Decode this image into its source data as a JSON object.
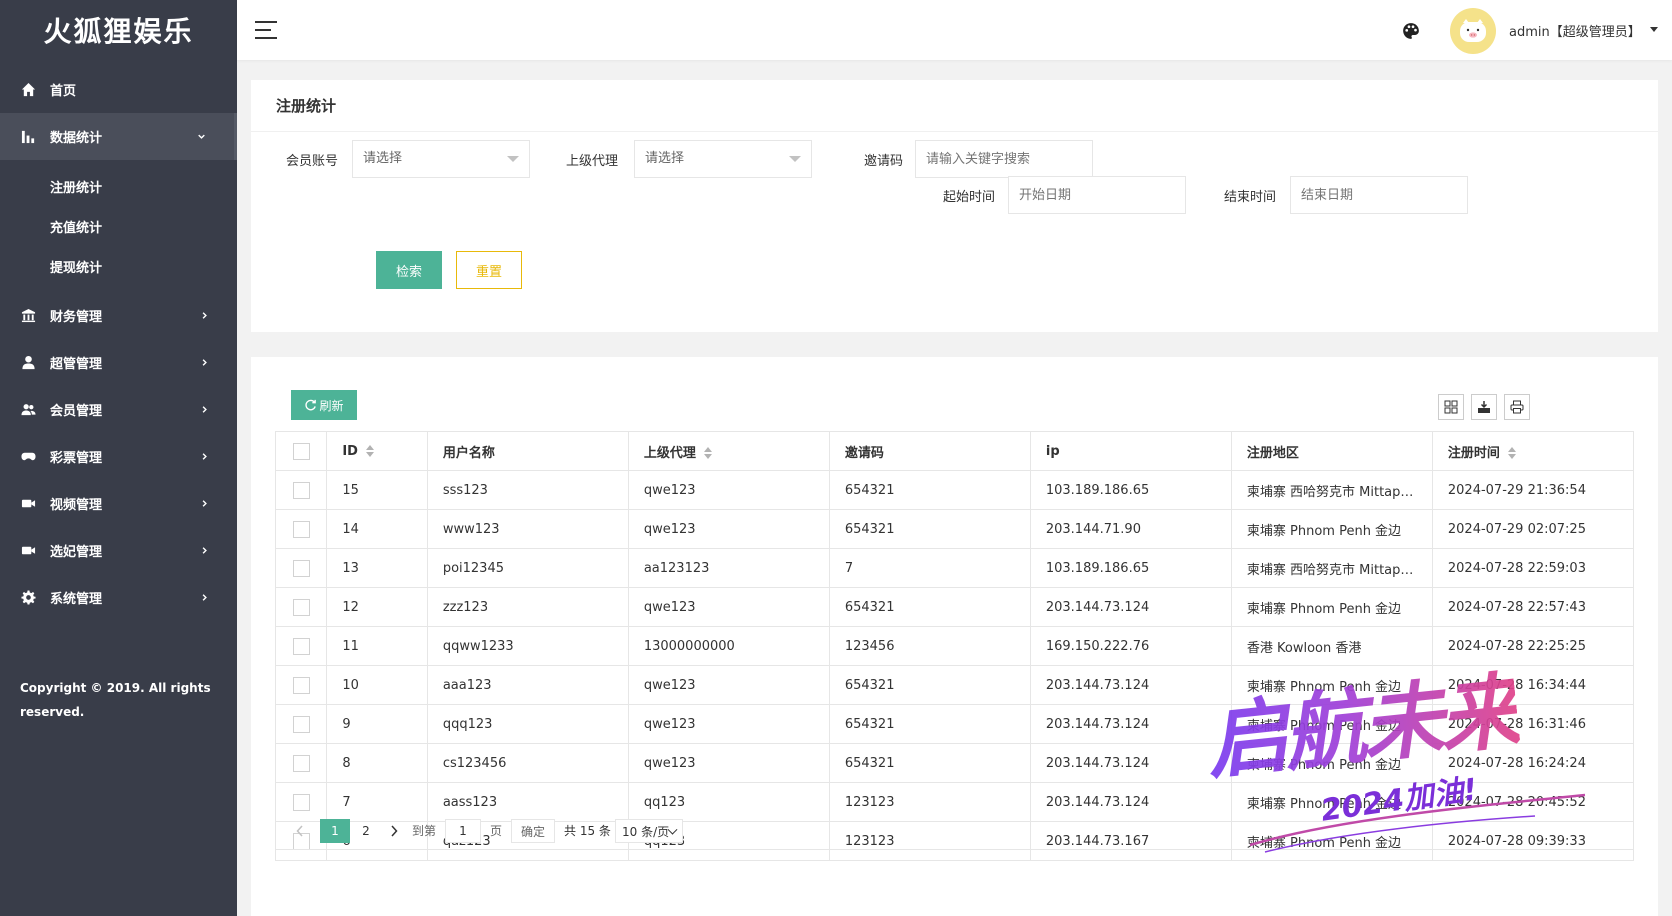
{
  "app": {
    "logo": "火狐狸娱乐",
    "copyright": "Copyright © 2019. All rights reserved."
  },
  "sidebar": {
    "items": [
      {
        "label": "首页",
        "icon": "home-icon"
      },
      {
        "label": "数据统计",
        "icon": "bar-chart-icon",
        "expanded": true
      },
      {
        "label": "财务管理",
        "icon": "bank-icon"
      },
      {
        "label": "超管管理",
        "icon": "user-icon"
      },
      {
        "label": "会员管理",
        "icon": "users-icon"
      },
      {
        "label": "彩票管理",
        "icon": "gamepad-icon"
      },
      {
        "label": "视频管理",
        "icon": "video-icon"
      },
      {
        "label": "选妃管理",
        "icon": "video-icon"
      },
      {
        "label": "系统管理",
        "icon": "gear-icon"
      }
    ],
    "subitems": [
      "注册统计",
      "充值统计",
      "提现统计"
    ]
  },
  "header": {
    "user": "admin【超级管理员】"
  },
  "search": {
    "title": "注册统计",
    "member_label": "会员账号",
    "member_placeholder": "请选择",
    "agent_label": "上级代理",
    "agent_placeholder": "请选择",
    "invite_label": "邀请码",
    "invite_placeholder": "请输入关键字搜索",
    "start_label": "起始时间",
    "start_placeholder": "开始日期",
    "end_label": "结束时间",
    "end_placeholder": "结束日期",
    "search_btn": "检索",
    "reset_btn": "重置"
  },
  "table": {
    "refresh_btn": "刷新",
    "columns": [
      "ID",
      "用户名称",
      "上级代理",
      "邀请码",
      "ip",
      "注册地区",
      "注册时间"
    ],
    "rows": [
      [
        "15",
        "sss123",
        "qwe123",
        "654321",
        "103.189.186.65",
        "柬埔寨 西哈努克市 Mittapheap",
        "2024-07-29 21:36:54"
      ],
      [
        "14",
        "www123",
        "qwe123",
        "654321",
        "203.144.71.90",
        "柬埔寨 Phnom Penh 金边",
        "2024-07-29 02:07:25"
      ],
      [
        "13",
        "poi12345",
        "aa123123",
        "7",
        "103.189.186.65",
        "柬埔寨 西哈努克市 Mittapheap",
        "2024-07-28 22:59:03"
      ],
      [
        "12",
        "zzz123",
        "qwe123",
        "654321",
        "203.144.73.124",
        "柬埔寨 Phnom Penh 金边",
        "2024-07-28 22:57:43"
      ],
      [
        "11",
        "qqww1233",
        "13000000000",
        "123456",
        "169.150.222.76",
        "香港 Kowloon 香港",
        "2024-07-28 22:25:25"
      ],
      [
        "10",
        "aaa123",
        "qwe123",
        "654321",
        "203.144.73.124",
        "柬埔寨 Phnom Penh 金边",
        "2024-07-28 16:34:44"
      ],
      [
        "9",
        "qqq123",
        "qwe123",
        "654321",
        "203.144.73.124",
        "柬埔寨 Phnom Penh 金边",
        "2024-07-28 16:31:46"
      ],
      [
        "8",
        "cs123456",
        "qwe123",
        "654321",
        "203.144.73.124",
        "柬埔寨 Phnom Penh 金边",
        "2024-07-28 16:24:24"
      ],
      [
        "7",
        "aass123",
        "qq123",
        "123123",
        "203.144.73.124",
        "柬埔寨 Phnom Penh 金边",
        "2024-07-28 20:45:52"
      ],
      [
        "6",
        "qaz123",
        "qq123",
        "123123",
        "203.144.73.167",
        "柬埔寨 Phnom Penh 金边",
        "2024-07-28 09:39:33"
      ]
    ]
  },
  "pager": {
    "page1": "1",
    "page2": "2",
    "goto": "到第",
    "current": "1",
    "page_unit": "页",
    "confirm": "确定",
    "total": "共 15 条",
    "size": "10 条/页"
  },
  "watermark": {
    "main": "启航未来",
    "sub": "2024加油!"
  }
}
